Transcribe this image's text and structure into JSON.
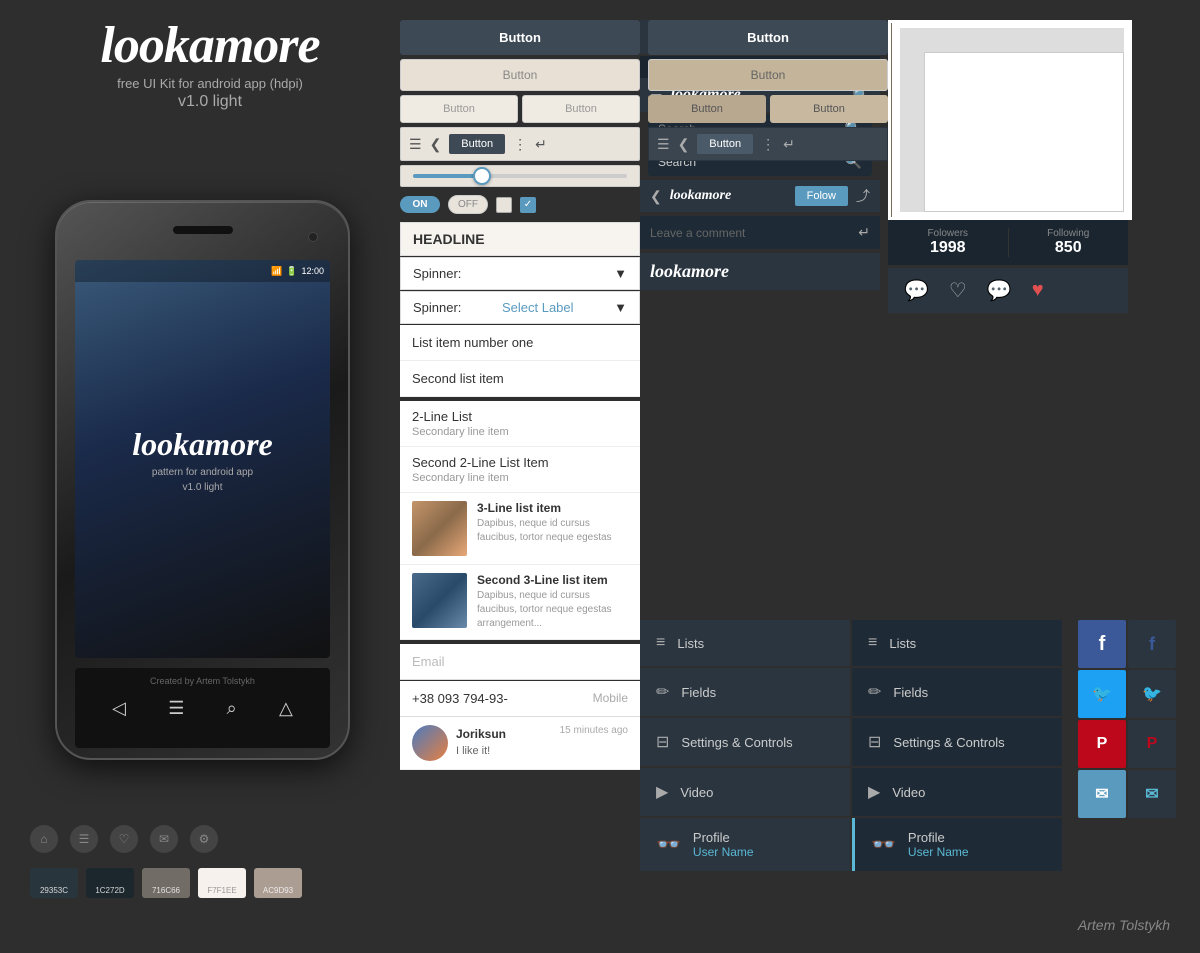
{
  "brand": {
    "logo": "lookamore",
    "tagline": "free UI Kit for android app (hdpi)",
    "version": "v1.0 light"
  },
  "buttons": {
    "dark_button": "Button",
    "light_button": "Button",
    "outline_button1": "Button",
    "outline_button2": "Button"
  },
  "dark_buttons": {
    "dark_button": "Button",
    "light_button": "Button",
    "outline_button1": "Button",
    "outline_button2": "Button"
  },
  "toggles": {
    "on_label": "ON",
    "off_label": "OFF"
  },
  "headline": "HEADLINE",
  "spinner1_label": "Spinner:",
  "spinner2_label": "Spinner:",
  "spinner2_value": "Select Label",
  "list_items": [
    {
      "primary": "List item number one",
      "secondary": null
    },
    {
      "primary": "Second list item",
      "secondary": null
    }
  ],
  "two_line_items": [
    {
      "primary": "2-Line List",
      "secondary": "Secondary line item"
    },
    {
      "primary": "Second 2-Line List Item",
      "secondary": "Secondary line item"
    }
  ],
  "three_line_items": [
    {
      "title": "3-Line list item",
      "desc": "Dapibus, neque id cursus faucibus, tortor neque egestas",
      "img": "girl"
    },
    {
      "title": "Second 3-Line list item",
      "desc": "Dapibus, neque id cursus faucibus, tortor neque egestas arrangement...",
      "img": "car"
    }
  ],
  "form": {
    "email_placeholder": "Email",
    "phone_value": "+38 093 794-93-",
    "phone_type": "Mobile"
  },
  "comment": {
    "username": "Joriksun",
    "time": "15 minutes ago",
    "text": "I like it!"
  },
  "dark_ui": {
    "logo": "lookamore",
    "search1_placeholder": "Search",
    "search2_value": "Search",
    "follow_label": "Folow",
    "comment_placeholder": "Leave a comment",
    "brand_logo": "lookamore"
  },
  "menu_items": [
    {
      "icon": "≡",
      "label": "Lists",
      "style": "normal"
    },
    {
      "icon": "≡",
      "label": "Lists",
      "style": "normal"
    },
    {
      "icon": "✏",
      "label": "Fields",
      "style": "normal"
    },
    {
      "icon": "✏",
      "label": "Fields",
      "style": "normal"
    },
    {
      "icon": "⊟",
      "label": "Settings & Controls",
      "style": "normal"
    },
    {
      "icon": "⊟",
      "label": "Settings & Controls",
      "style": "normal"
    },
    {
      "icon": "▶",
      "label": "Video",
      "style": "normal"
    },
    {
      "icon": "▶",
      "label": "Video",
      "style": "normal"
    }
  ],
  "profile_items": [
    {
      "icon": "👓",
      "label": "Profile",
      "username": "User Name",
      "variant": "dark"
    },
    {
      "icon": "👓",
      "label": "Profile",
      "username": "User Name",
      "variant": "cyan"
    }
  ],
  "stats": {
    "followers_label": "Folowers",
    "followers_value": "1998",
    "following_label": "Following",
    "following_value": "850"
  },
  "social_buttons": [
    {
      "icon": "f",
      "type": "facebook"
    },
    {
      "icon": "𝕥",
      "type": "twitter"
    },
    {
      "icon": "P",
      "type": "pinterest"
    },
    {
      "icon": "✉",
      "type": "mail"
    }
  ],
  "phone": {
    "status_time": "12:00",
    "logo": "lookamore",
    "pattern": "pattern for android app",
    "version": "v1.0 light",
    "created_by": "Created by Artem Tolstykh"
  },
  "colors": [
    {
      "hex": "#29353C",
      "label": "29353C"
    },
    {
      "hex": "#1C272D",
      "label": "1C272D"
    },
    {
      "hex": "#716C66",
      "label": "716C66"
    },
    {
      "hex": "#F7F1EE",
      "label": "F7F1EE"
    },
    {
      "hex": "#AC9D93",
      "label": "AC9D93"
    }
  ],
  "credit": "Artem Tolstykh"
}
